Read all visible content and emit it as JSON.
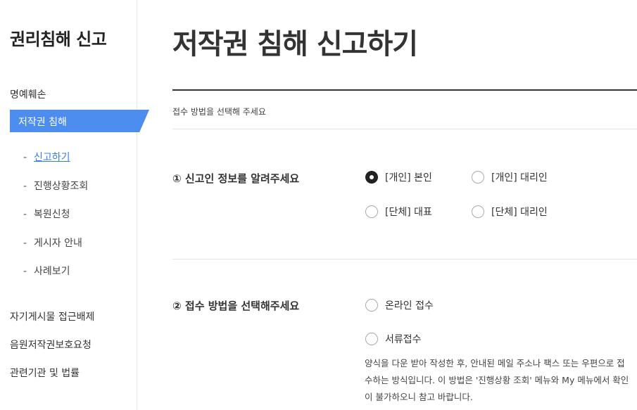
{
  "sidebar": {
    "title": "권리침해 신고",
    "menu_top": "명예훼손",
    "menu_active": "저작권 침해",
    "sub_items": [
      {
        "dash": "-",
        "label": "신고하기"
      },
      {
        "dash": "-",
        "label": "진행상황조회"
      },
      {
        "dash": "-",
        "label": "복원신청"
      },
      {
        "dash": "-",
        "label": "게시자 안내"
      },
      {
        "dash": "-",
        "label": "사례보기"
      }
    ],
    "menu_bottom": [
      "자기게시물 접근배제",
      "음원저작권보호요청",
      "관련기관 및 법률"
    ]
  },
  "main": {
    "title": "저작권 침해 신고하기",
    "instruction": "접수 방법을 선택해 주세요",
    "section1": {
      "label": "① 신고인 정보를 알려주세요",
      "options": [
        {
          "label": "[개인] 본인",
          "checked": true
        },
        {
          "label": "[개인] 대리인",
          "checked": false
        },
        {
          "label": "[단체] 대표",
          "checked": false
        },
        {
          "label": "[단체] 대리인",
          "checked": false
        }
      ]
    },
    "section2": {
      "label": "② 접수 방법을 선택해주세요",
      "options": [
        {
          "label": "온라인 접수",
          "checked": false
        },
        {
          "label": "서류접수",
          "checked": false
        }
      ],
      "description": "양식을 다운 받아 작성한 후, 안내된 메일 주소나 팩스 또는 우편으로 접수하는 방식입니다. 이 방법은 '진행상황 조회' 메뉴와 My 메뉴에서 확인이 불가하오니 참고 바랍니다."
    }
  }
}
